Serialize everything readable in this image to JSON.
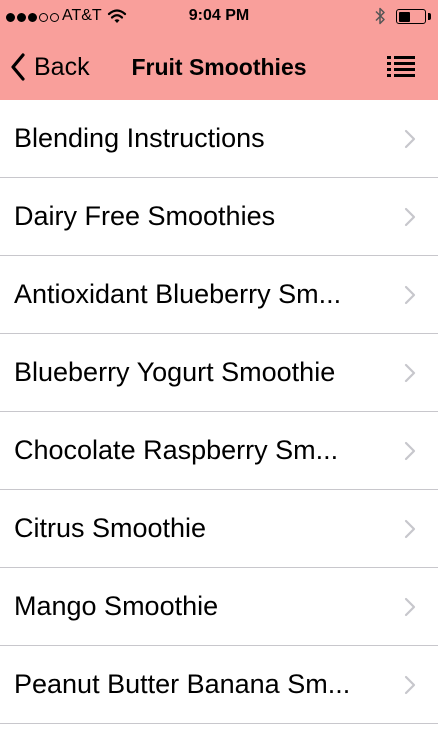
{
  "status_bar": {
    "carrier": "AT&T",
    "time": "9:04 PM",
    "signal_bars_filled": 3,
    "signal_bars_total": 5
  },
  "nav": {
    "back_label": "Back",
    "title": "Fruit Smoothies",
    "menu_icon": "list-icon"
  },
  "colors": {
    "header_bg": "#f99f9b",
    "separator": "#c8c7cc",
    "chevron": "#c7c7cc"
  },
  "list": {
    "items": [
      {
        "label": "Blending Instructions"
      },
      {
        "label": "Dairy Free Smoothies"
      },
      {
        "label": "Antioxidant Blueberry Sm..."
      },
      {
        "label": "Blueberry Yogurt Smoothie"
      },
      {
        "label": "Chocolate Raspberry Sm..."
      },
      {
        "label": "Citrus Smoothie"
      },
      {
        "label": "Mango Smoothie"
      },
      {
        "label": "Peanut Butter Banana Sm..."
      }
    ]
  }
}
